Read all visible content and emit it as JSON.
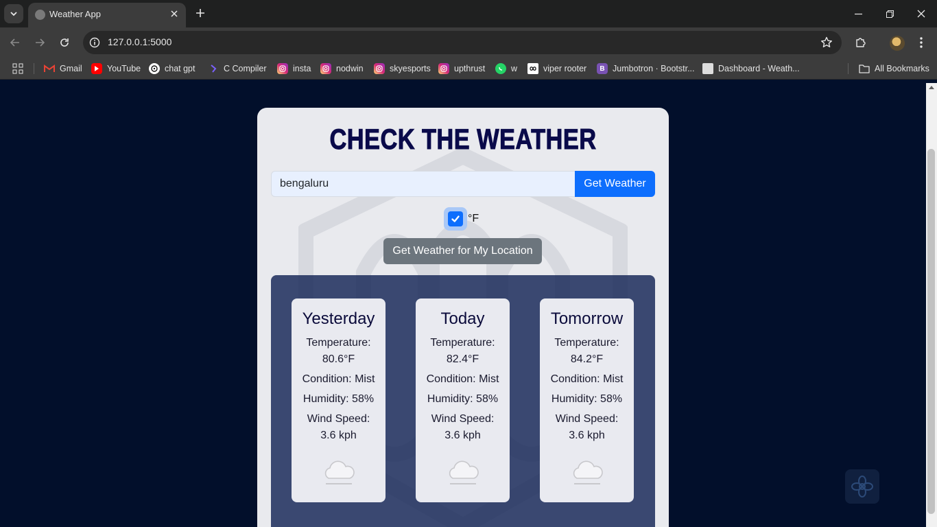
{
  "browser": {
    "tab_title": "Weather App",
    "url": "127.0.0.1:5000",
    "bookmarks": [
      {
        "label": "Gmail",
        "icon": "gmail-icon",
        "color": "#ea4335"
      },
      {
        "label": "YouTube",
        "icon": "youtube-icon",
        "color": "#ff0000"
      },
      {
        "label": "chat gpt",
        "icon": "chatgpt-icon",
        "color": "#ffffff"
      },
      {
        "label": "C Compiler",
        "icon": "compiler-icon",
        "color": "#7b61ff"
      },
      {
        "label": "insta",
        "icon": "instagram-icon",
        "color": "#d62976"
      },
      {
        "label": "nodwin",
        "icon": "instagram-icon",
        "color": "#d62976"
      },
      {
        "label": "skyesports",
        "icon": "instagram-icon",
        "color": "#d62976"
      },
      {
        "label": "upthrust",
        "icon": "instagram-icon",
        "color": "#d62976"
      },
      {
        "label": "w",
        "icon": "whatsapp-icon",
        "color": "#25d366"
      },
      {
        "label": "viper rooter",
        "icon": "link-icon",
        "color": "#ffffff"
      },
      {
        "label": "Jumbotron · Bootstr...",
        "icon": "bootstrap-icon",
        "color": "#7952b3"
      },
      {
        "label": "Dashboard - Weath...",
        "icon": "page-icon",
        "color": "#dddddd"
      }
    ],
    "all_bookmarks_label": "All Bookmarks"
  },
  "app": {
    "title": "CHECK THE WEATHER",
    "search": {
      "value": "bengaluru",
      "button_label": "Get Weather"
    },
    "unit_toggle": {
      "checked": true,
      "label": "°F"
    },
    "location_button_label": "Get Weather for My Location",
    "forecast": [
      {
        "day": "Yesterday",
        "temp_label": "Temperature:",
        "temp": "80.6°F",
        "condition": "Condition: Mist",
        "humidity": "Humidity: 58%",
        "wind_label": "Wind Speed:",
        "wind": "3.6 kph",
        "icon": "cloud-icon"
      },
      {
        "day": "Today",
        "temp_label": "Temperature:",
        "temp": "82.4°F",
        "condition": "Condition: Mist",
        "humidity": "Humidity: 58%",
        "wind_label": "Wind Speed:",
        "wind": "3.6 kph",
        "icon": "cloud-icon"
      },
      {
        "day": "Tomorrow",
        "temp_label": "Temperature:",
        "temp": "84.2°F",
        "condition": "Condition: Mist",
        "humidity": "Humidity: 58%",
        "wind_label": "Wind Speed:",
        "wind": "3.6 kph",
        "icon": "cloud-icon"
      }
    ]
  },
  "colors": {
    "page_background": "#020f2b",
    "card_background": "#e9eaee",
    "primary": "#0d6efd",
    "secondary": "#6c757d",
    "title": "#0a0a4a",
    "forecast_panel": "#142456"
  }
}
